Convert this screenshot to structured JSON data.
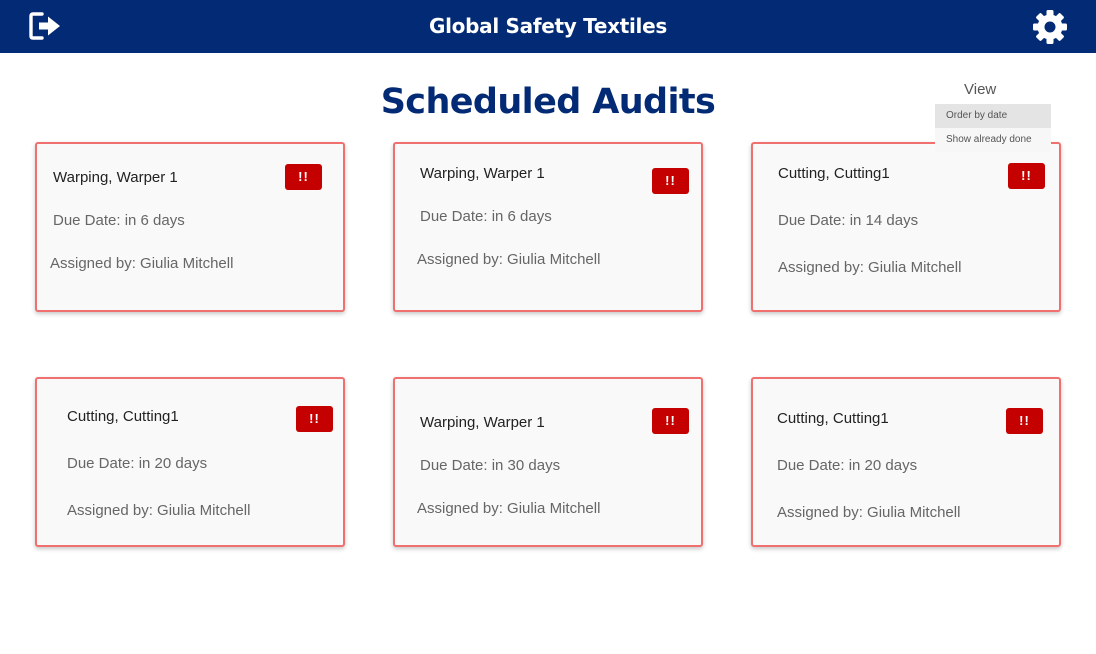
{
  "header": {
    "title": "Global Safety Textiles",
    "logout_icon": "logout-icon",
    "settings_icon": "gear-icon"
  },
  "page": {
    "title": "Scheduled Audits"
  },
  "view_menu": {
    "label": "View",
    "options": [
      {
        "label": "Order by date",
        "selected": true
      },
      {
        "label": "Show already done",
        "selected": false
      }
    ]
  },
  "audits": [
    {
      "title": "Warping, Warper 1",
      "due": "Due Date: in 6 days",
      "assigned": "Assigned by: Giulia Mitchell",
      "badge": "!!"
    },
    {
      "title": "Warping, Warper 1",
      "due": "Due Date: in 6 days",
      "assigned": "Assigned by: Giulia Mitchell",
      "badge": "!!"
    },
    {
      "title": "Cutting, Cutting1",
      "due": "Due Date: in 14 days",
      "assigned": "Assigned by: Giulia Mitchell",
      "badge": "!!"
    },
    {
      "title": "Cutting, Cutting1",
      "due": "Due Date: in 20 days",
      "assigned": "Assigned by: Giulia Mitchell",
      "badge": "!!"
    },
    {
      "title": "Warping, Warper 1",
      "due": "Due Date: in 30 days",
      "assigned": "Assigned by: Giulia Mitchell",
      "badge": "!!"
    },
    {
      "title": "Cutting, Cutting1",
      "due": "Due Date: in 20 days",
      "assigned": "Assigned by: Giulia Mitchell",
      "badge": "!!"
    }
  ],
  "colors": {
    "header_bg": "#032a74",
    "title": "#032a74",
    "card_border": "#f07070",
    "badge_bg": "#c50000"
  }
}
